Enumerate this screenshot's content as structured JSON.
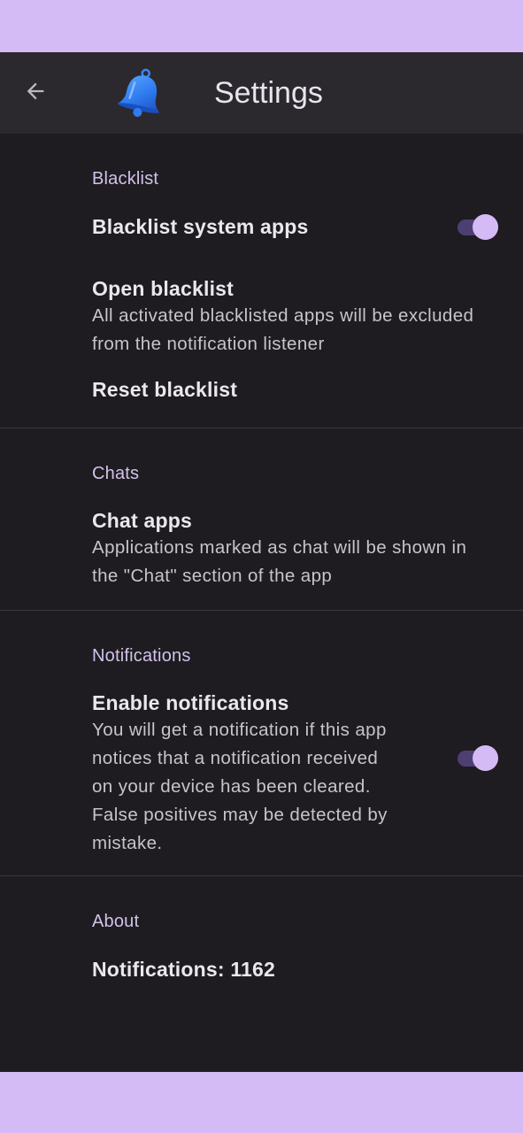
{
  "colors": {
    "frame_background": "#d4bbf6",
    "screen_background": "#1e1c20",
    "appbar_background": "#2b292e",
    "accent": "#d4bbf6",
    "switch_track": "#4e3f73"
  },
  "appbar": {
    "back_icon": "arrow-back-icon",
    "logo_icon": "bell-icon",
    "title": "Settings"
  },
  "sections": {
    "blacklist": {
      "header": "Blacklist",
      "system_apps": {
        "title": "Blacklist system apps",
        "enabled": true
      },
      "open": {
        "title": "Open blacklist",
        "summary_line1": "All activated blacklisted apps will be excluded",
        "summary_line2": "from the notification listener"
      },
      "reset": {
        "title": "Reset blacklist"
      }
    },
    "chats": {
      "header": "Chats",
      "chat_apps": {
        "title": "Chat apps",
        "summary_line1": "Applications marked as chat will be shown in",
        "summary_line2": "the \"Chat\" section of the app"
      }
    },
    "notifications": {
      "header": "Notifications",
      "enable": {
        "title": "Enable notifications",
        "summary_lines": [
          "You will get a notification if this app",
          "notices that a notification received",
          "on your device has been cleared.",
          "False positives may be detected by",
          "mistake."
        ],
        "enabled": true
      }
    },
    "about": {
      "header": "About",
      "count": {
        "title": "Notifications: 1162"
      }
    }
  }
}
